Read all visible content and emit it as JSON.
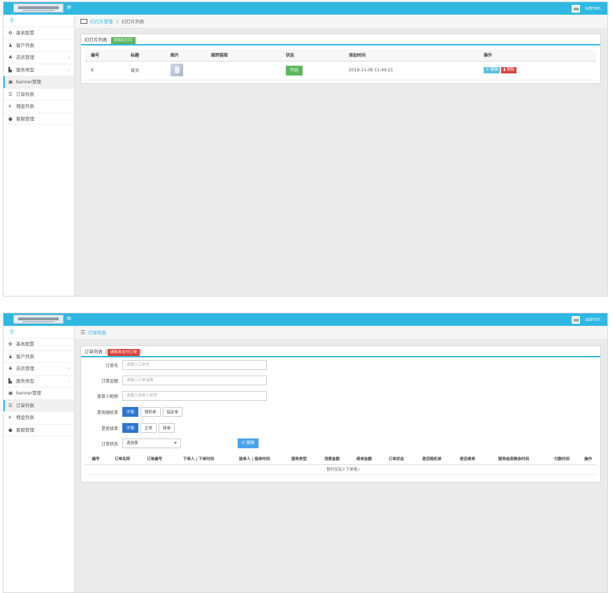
{
  "topbar": {
    "user": "admin",
    "menu_icon": "bars-icon"
  },
  "sidebar": {
    "items": [
      {
        "label": "基本配置",
        "icon": "gear-icon"
      },
      {
        "label": "客户列表",
        "icon": "user-icon"
      },
      {
        "label": "店员管理",
        "icon": "users-icon",
        "arrow": "›"
      },
      {
        "label": "服务类型",
        "icon": "chart-icon",
        "arrow": "›"
      },
      {
        "label": "banner管理",
        "icon": "image-icon"
      },
      {
        "label": "订单列表",
        "icon": "list-icon"
      },
      {
        "label": "佣金列表",
        "icon": "yen-icon"
      },
      {
        "label": "客服管理",
        "icon": "comment-icon"
      }
    ]
  },
  "screen1": {
    "breadcrumb": {
      "parent": "幻灯片管理",
      "separator": "/",
      "current": "幻灯片列表"
    },
    "box_title": "幻灯片列表",
    "add_button": "添加幻灯片",
    "columns": [
      "编号",
      "标题",
      "图片",
      "跳转链接",
      "状态",
      "添加时间",
      "操作"
    ],
    "rows": [
      {
        "id": "8",
        "title": "首页",
        "link": "",
        "status": "开启",
        "time": "2019-11-06 11:49:21",
        "edit": "编辑",
        "delete": "删除"
      }
    ]
  },
  "screen2": {
    "breadcrumb": {
      "current": "订单列表"
    },
    "box_title": "订单列表",
    "clear_button": "清除未支付订单",
    "bracket_open": "[",
    "bracket_close": "]",
    "form": {
      "order_no": {
        "label": "订单号",
        "placeholder": "请输入订单号"
      },
      "amount": {
        "label": "订单金额",
        "placeholder": "请输入订单金额"
      },
      "nickname": {
        "label": "接单人昵称",
        "placeholder": "请输入接单人昵称"
      },
      "random": {
        "label": "是否随机单",
        "options": [
          "不限",
          "随机单",
          "指定单"
        ]
      },
      "renew": {
        "label": "是否续单",
        "options": [
          "不限",
          "正常",
          "续单"
        ]
      },
      "status": {
        "label": "订单状态",
        "value": "请选择"
      },
      "search": "搜索"
    },
    "columns": [
      "编号",
      "订单名称",
      "订单编号",
      "下单人 | 下单时间",
      "接单人 | 接单时间",
      "服务类型",
      "消费金额",
      "续单金额",
      "订单状态",
      "是否随机单",
      "是否续单",
      "服务结束剩余时间",
      "付款时间",
      "操作"
    ],
    "empty_text": "暂时没有人下单哦~"
  }
}
